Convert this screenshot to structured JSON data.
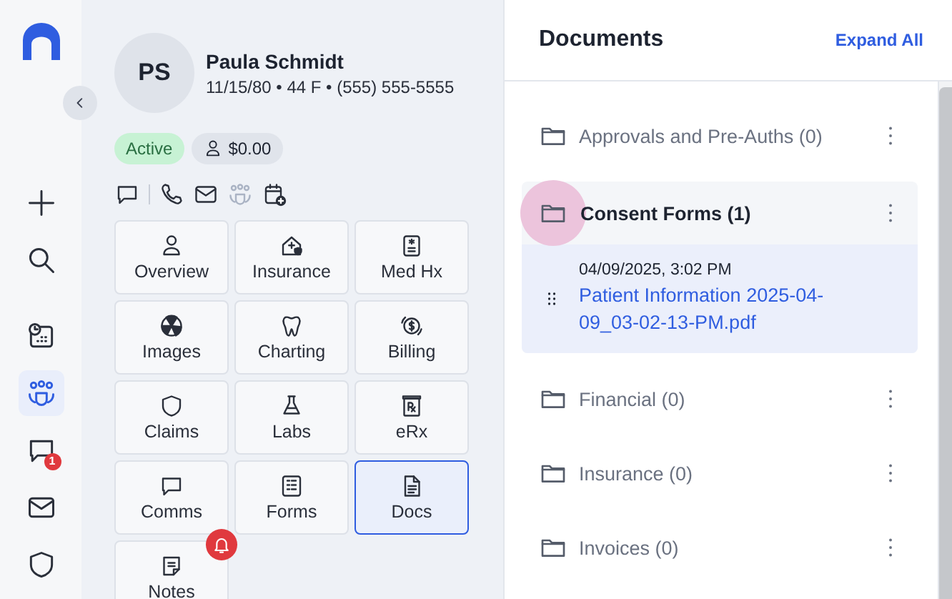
{
  "rail": {
    "items": [
      {
        "selected": false
      },
      {
        "selected": false
      },
      {
        "selected": false
      },
      {
        "selected": true
      },
      {
        "selected": false,
        "badge": "1"
      },
      {
        "selected": false
      },
      {
        "selected": false
      }
    ]
  },
  "patient": {
    "initials": "PS",
    "name": "Paula Schmidt",
    "details": "11/15/80 • 44 F • (555) 555-5555",
    "status": "Active",
    "balance": "$0.00"
  },
  "tiles": [
    {
      "label": "Overview",
      "selected": false,
      "alert": false
    },
    {
      "label": "Insurance",
      "selected": false,
      "alert": false
    },
    {
      "label": "Med Hx",
      "selected": false,
      "alert": false
    },
    {
      "label": "Images",
      "selected": false,
      "alert": false
    },
    {
      "label": "Charting",
      "selected": false,
      "alert": false
    },
    {
      "label": "Billing",
      "selected": false,
      "alert": false
    },
    {
      "label": "Claims",
      "selected": false,
      "alert": false
    },
    {
      "label": "Labs",
      "selected": false,
      "alert": false
    },
    {
      "label": "eRx",
      "selected": false,
      "alert": false
    },
    {
      "label": "Comms",
      "selected": false,
      "alert": false
    },
    {
      "label": "Forms",
      "selected": false,
      "alert": false
    },
    {
      "label": "Docs",
      "selected": true,
      "alert": false
    },
    {
      "label": "Notes",
      "selected": false,
      "alert": true
    }
  ],
  "documents": {
    "title": "Documents",
    "action": "Expand All",
    "folders": [
      {
        "label": "Approvals and Pre-Auths (0)",
        "expanded": false,
        "focused": false
      },
      {
        "label": "Consent Forms (1)",
        "expanded": true,
        "focused": true,
        "files": [
          {
            "date": "04/09/2025, 3:02 PM",
            "name": "Patient Information 2025-04-09_03-02-13-PM.pdf"
          }
        ]
      },
      {
        "label": "Financial (0)",
        "expanded": false,
        "focused": false
      },
      {
        "label": "Insurance (0)",
        "expanded": false,
        "focused": false
      },
      {
        "label": "Invoices (0)",
        "expanded": false,
        "focused": false
      }
    ]
  }
}
